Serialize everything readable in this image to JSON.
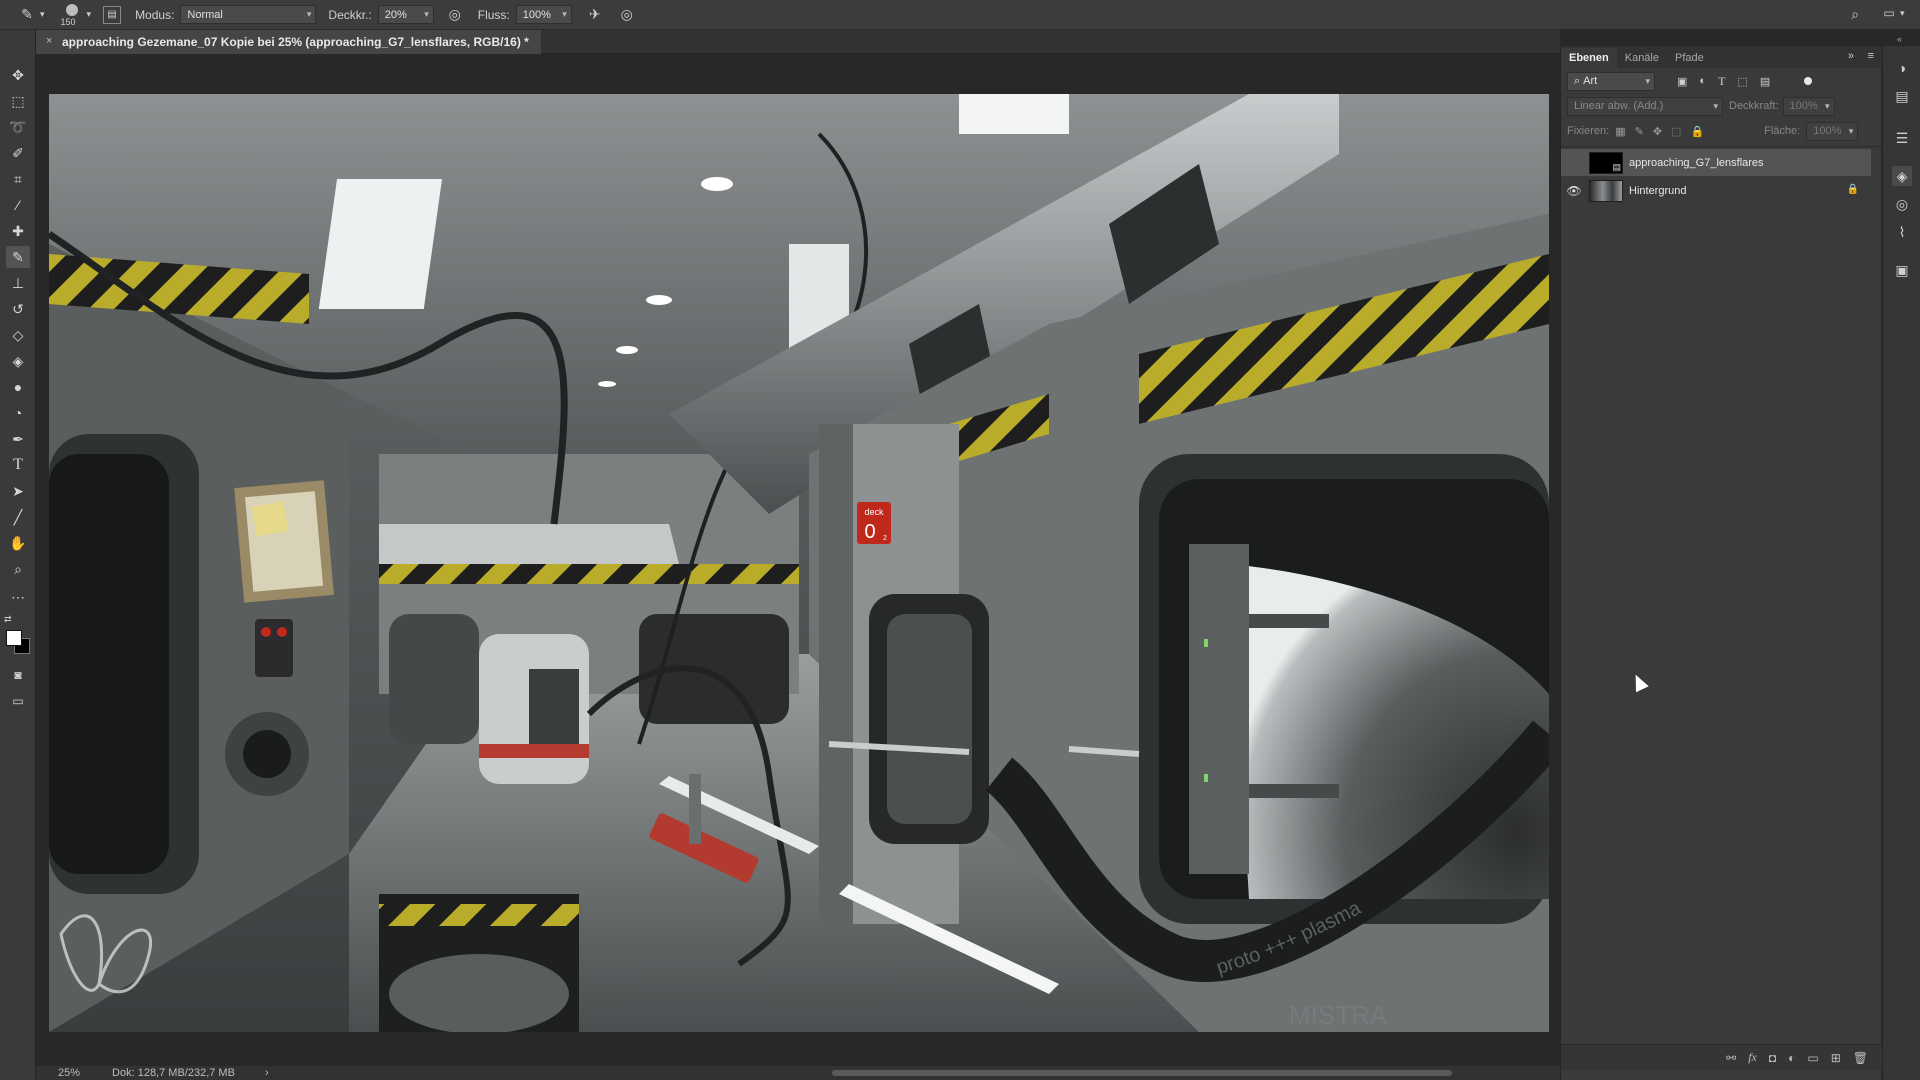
{
  "options_bar": {
    "brush_size": "150",
    "mode_label": "Modus:",
    "mode_value": "Normal",
    "opacity_label": "Deckkr.:",
    "opacity_value": "20%",
    "flow_label": "Fluss:",
    "flow_value": "100%"
  },
  "document": {
    "tab_title": "approaching Gezemane_07 Kopie bei 25% (approaching_G7_lensflares, RGB/16) *",
    "close_glyph": "×"
  },
  "artwork": {
    "deck_sign_label": "deck",
    "deck_sign_number": "0",
    "deck_sign_sub": "2",
    "hose_text": "proto +++ plasma",
    "floor_text": "MISTRA"
  },
  "statusbar": {
    "zoom": "25%",
    "doc_info": "Dok: 128,7 MB/232,7 MB",
    "arrow": "›"
  },
  "layers_panel": {
    "tabs": [
      {
        "label": "Ebenen"
      },
      {
        "label": "Kanäle"
      },
      {
        "label": "Pfade"
      }
    ],
    "filter_value": "Art",
    "blend_mode": "Linear abw. (Add.)",
    "opacity_label": "Deckkraft:",
    "opacity_value": "100%",
    "lock_label": "Fixieren:",
    "fill_label": "Fläche:",
    "fill_value": "100%",
    "layers": [
      {
        "name": "approaching_G7_lensflares"
      },
      {
        "name": "Hintergrund"
      }
    ]
  },
  "colors": {
    "accent": "#545454",
    "sign_red": "#c0281c",
    "hazard_yellow": "#b8ac2a"
  }
}
